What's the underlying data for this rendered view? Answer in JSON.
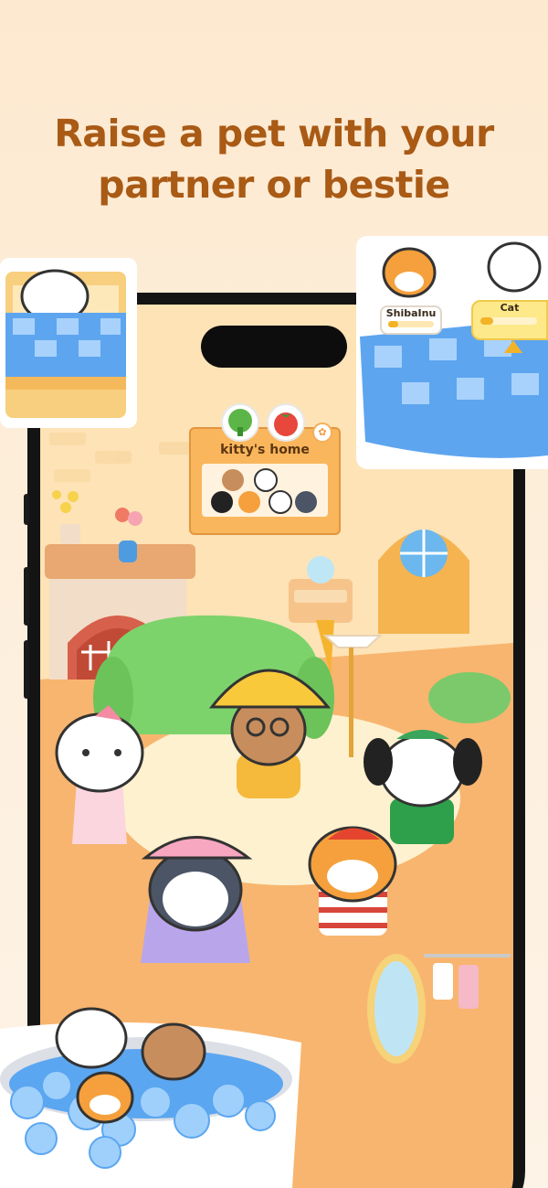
{
  "headline": {
    "line1": "Raise a pet with your",
    "line2": "partner or bestie"
  },
  "home_panel": {
    "title": "kitty's home",
    "avatar_left_icon": "broccoli-icon",
    "avatar_right_icon": "tomato-icon",
    "corner_icon": "paw-icon"
  },
  "dining_tags": {
    "left": "ShibaInu",
    "right": "Cat"
  },
  "colors": {
    "headline": "#a95a15",
    "background": "#fde9cf",
    "floor": "#f8b56f",
    "wall": "#fde3b6",
    "sofa": "#7dd36b",
    "accent_orange": "#f5a03c"
  }
}
